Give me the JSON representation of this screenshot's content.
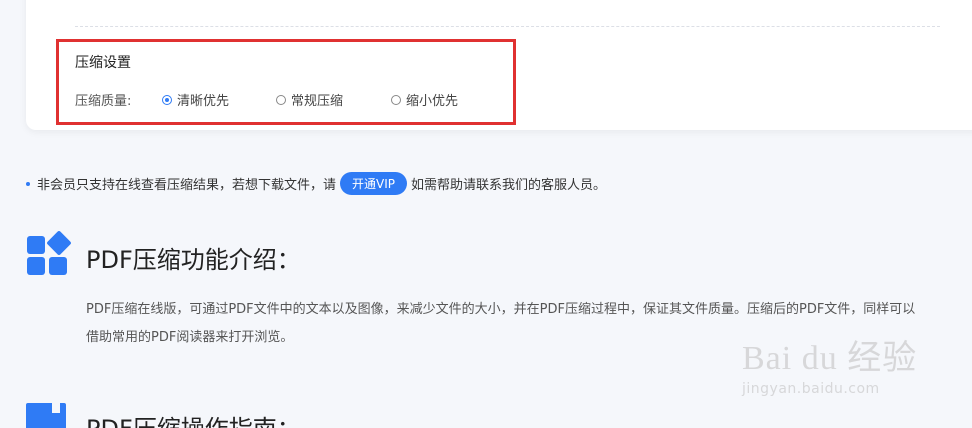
{
  "compression": {
    "title": "压缩设置",
    "quality_label": "压缩质量:",
    "options": [
      {
        "label": "清晰优先",
        "checked": true
      },
      {
        "label": "常规压缩",
        "checked": false
      },
      {
        "label": "缩小优先",
        "checked": false
      }
    ]
  },
  "notice": {
    "text_before": "非会员只支持在线查看压缩结果，若想下载文件，请",
    "vip_button": "开通VIP",
    "text_after": "如需帮助请联系我们的客服人员。"
  },
  "intro": {
    "title": "PDF压缩功能介绍：",
    "line1": "PDF压缩在线版，可通过PDF文件中的文本以及图像，来减少文件的大小，并在PDF压缩过程中，保证其文件质量。压缩后的PDF文件，同样可以",
    "line2": "借助常用的PDF阅读器来打开浏览。"
  },
  "guide": {
    "title": "PDF压缩操作指南："
  },
  "watermark": {
    "main": "Bai du 经验",
    "sub": "jingyan.baidu.com"
  },
  "colors": {
    "accent": "#2f7bf5",
    "highlight": "#e03131"
  }
}
